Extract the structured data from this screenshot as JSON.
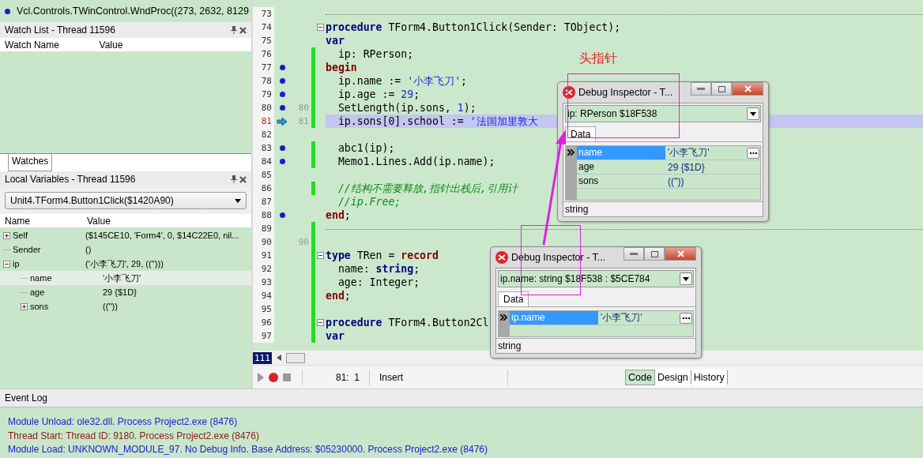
{
  "call_stack": {
    "entries": [
      {
        "text": "Vcl.Controls.TWinControl.WndProc((273, 2632, 8129"
      }
    ]
  },
  "watch_list": {
    "title": "Watch List - Thread 11596",
    "columns": [
      "Watch Name",
      "Value"
    ],
    "tabs": [
      {
        "label": "Watches",
        "selected": true
      }
    ]
  },
  "local_variables": {
    "title": "Local Variables - Thread 11596",
    "frame": "Unit4.TForm4.Button1Click($1420A90)",
    "columns": [
      "Name",
      "Value"
    ],
    "rows": [
      {
        "kind": "branch",
        "expanded": false,
        "selected": false,
        "name": "Self",
        "value": "($145CE10, 'Form4', 0, $14C22E0, nil..."
      },
      {
        "kind": "leaf",
        "selected": false,
        "name": "Sender",
        "value": "()"
      },
      {
        "kind": "branch",
        "expanded": true,
        "selected": false,
        "name": "ip",
        "value": "('小李飞刀', 29, (('')))",
        "children": [
          {
            "kind": "leaf",
            "selected": true,
            "name": "name",
            "value": "'小李飞刀'"
          },
          {
            "kind": "leaf",
            "selected": false,
            "name": "age",
            "value": "29 {$1D}"
          },
          {
            "kind": "branch",
            "expanded": false,
            "selected": false,
            "name": "sons",
            "value": "((''))"
          }
        ]
      }
    ]
  },
  "editor": {
    "lines": [
      {
        "number": "73",
        "kind": "separator",
        "breakpoint": false,
        "current": false,
        "modified": false,
        "fold": false
      },
      {
        "number": "74",
        "kind": "code",
        "breakpoint": false,
        "current": false,
        "modified": false,
        "fold": true,
        "tokens": [
          {
            "kind": "keyword",
            "text": "procedure"
          },
          {
            "kind": "plain",
            "text": " TForm4.Button1Click(Sender: TObject);"
          }
        ]
      },
      {
        "number": "75",
        "kind": "code",
        "breakpoint": false,
        "current": false,
        "modified": false,
        "fold": false,
        "tokens": [
          {
            "kind": "keyword",
            "text": "var"
          }
        ]
      },
      {
        "number": "76",
        "kind": "code",
        "breakpoint": false,
        "current": false,
        "modified": true,
        "fold": false,
        "tokens": [
          {
            "kind": "plain",
            "text": "  ip: RPerson;"
          }
        ]
      },
      {
        "number": "77",
        "kind": "code",
        "breakpoint": true,
        "current": false,
        "modified": true,
        "fold": false,
        "tokens": [
          {
            "kind": "block",
            "text": "begin"
          }
        ]
      },
      {
        "number": "78",
        "kind": "code",
        "breakpoint": true,
        "current": false,
        "modified": true,
        "fold": false,
        "tokens": [
          {
            "kind": "plain",
            "text": "  ip.name := "
          },
          {
            "kind": "string",
            "text": "'小李飞刀'"
          },
          {
            "kind": "plain",
            "text": ";"
          }
        ]
      },
      {
        "number": "79",
        "kind": "code",
        "breakpoint": true,
        "current": false,
        "modified": true,
        "fold": false,
        "tokens": [
          {
            "kind": "plain",
            "text": "  ip.age := "
          },
          {
            "kind": "number",
            "text": "29"
          },
          {
            "kind": "plain",
            "text": ";"
          }
        ]
      },
      {
        "number": "80",
        "kind": "code",
        "compiled": "80",
        "breakpoint": true,
        "current": false,
        "modified": true,
        "fold": false,
        "tokens": [
          {
            "kind": "plain",
            "text": "  SetLength(ip.sons, "
          },
          {
            "kind": "number",
            "text": "1"
          },
          {
            "kind": "plain",
            "text": ");"
          }
        ]
      },
      {
        "number": "81",
        "kind": "code",
        "compiled": "81",
        "breakpoint": false,
        "current": true,
        "modified": true,
        "fold": false,
        "tokens": [
          {
            "kind": "plain",
            "text": "  ip.sons[0].school := "
          },
          {
            "kind": "string",
            "text": "'法国加里敦大"
          }
        ]
      },
      {
        "number": "82",
        "kind": "code",
        "breakpoint": false,
        "current": false,
        "modified": false,
        "fold": false
      },
      {
        "number": "83",
        "kind": "code",
        "breakpoint": true,
        "current": false,
        "modified": true,
        "fold": false,
        "tokens": [
          {
            "kind": "plain",
            "text": "  abc1(ip);"
          }
        ]
      },
      {
        "number": "84",
        "kind": "code",
        "breakpoint": true,
        "current": false,
        "modified": true,
        "fold": false,
        "tokens": [
          {
            "kind": "plain",
            "text": "  Memo1.Lines.Add(ip.name);"
          }
        ]
      },
      {
        "number": "85",
        "kind": "code",
        "breakpoint": false,
        "current": false,
        "modified": false,
        "fold": false
      },
      {
        "number": "86",
        "kind": "code",
        "breakpoint": false,
        "current": false,
        "modified": true,
        "fold": false,
        "tokens": [
          {
            "kind": "comment",
            "text": "  //结构不需要释放,指针出栈后,引用计"
          }
        ]
      },
      {
        "number": "87",
        "kind": "code",
        "breakpoint": false,
        "current": false,
        "modified": false,
        "fold": false,
        "tokens": [
          {
            "kind": "comment",
            "text": "  //ip.Free;"
          }
        ]
      },
      {
        "number": "88",
        "kind": "code",
        "breakpoint": true,
        "current": false,
        "modified": false,
        "fold": false,
        "tokens": [
          {
            "kind": "block",
            "text": "end"
          },
          {
            "kind": "plain",
            "text": ";"
          }
        ]
      },
      {
        "number": "89",
        "kind": "separator",
        "breakpoint": false,
        "current": false,
        "modified": true,
        "fold": false
      },
      {
        "number": "90",
        "kind": "code",
        "compiled": "90",
        "breakpoint": false,
        "current": false,
        "modified": true,
        "fold": false
      },
      {
        "number": "91",
        "kind": "code",
        "breakpoint": false,
        "current": false,
        "modified": true,
        "fold": true,
        "tokens": [
          {
            "kind": "keyword",
            "text": "type"
          },
          {
            "kind": "plain",
            "text": " TRen = "
          },
          {
            "kind": "block",
            "text": "record"
          }
        ]
      },
      {
        "number": "92",
        "kind": "code",
        "breakpoint": false,
        "current": false,
        "modified": true,
        "fold": false,
        "tokens": [
          {
            "kind": "plain",
            "text": "  name: "
          },
          {
            "kind": "keyword",
            "text": "string"
          },
          {
            "kind": "plain",
            "text": ";"
          }
        ]
      },
      {
        "number": "93",
        "kind": "code",
        "breakpoint": false,
        "current": false,
        "modified": true,
        "fold": false,
        "tokens": [
          {
            "kind": "plain",
            "text": "  age: Integer;"
          }
        ]
      },
      {
        "number": "94",
        "kind": "code",
        "breakpoint": false,
        "current": false,
        "modified": true,
        "fold": false,
        "tokens": [
          {
            "kind": "block",
            "text": "end"
          },
          {
            "kind": "plain",
            "text": ";"
          }
        ]
      },
      {
        "number": "95",
        "kind": "code",
        "breakpoint": false,
        "current": false,
        "modified": true,
        "fold": false
      },
      {
        "number": "96",
        "kind": "code",
        "breakpoint": false,
        "current": false,
        "modified": true,
        "fold": true,
        "tokens": [
          {
            "kind": "keyword",
            "text": "procedure"
          },
          {
            "kind": "plain",
            "text": " TForm4.Button2Cl"
          }
        ]
      },
      {
        "number": "97",
        "kind": "code",
        "breakpoint": false,
        "current": false,
        "modified": true,
        "fold": false,
        "tokens": [
          {
            "kind": "keyword",
            "text": "var"
          }
        ]
      }
    ],
    "bottom_line": "111"
  },
  "status_bar": {
    "position": "81:  1",
    "mode": "Insert",
    "tabs": [
      {
        "label": "Code",
        "selected": true
      },
      {
        "label": "Design",
        "selected": false
      },
      {
        "label": "History",
        "selected": false
      }
    ]
  },
  "inspectors": [
    {
      "title": "Debug Inspector - T...",
      "expression": "ip: RPerson $18F538",
      "tab": "Data",
      "footer": "string",
      "rows": [
        {
          "name": "name",
          "value": "'小李飞刀'",
          "selected": true
        },
        {
          "name": "age",
          "value": "29 {$1D}",
          "selected": false
        },
        {
          "name": "sons",
          "value": "((''))",
          "selected": false
        }
      ]
    },
    {
      "title": "Debug Inspector - T...",
      "expression": "ip.name: string $18F538 : $5CE784",
      "tab": "Data",
      "footer": "string",
      "rows": [
        {
          "name": "ip.name",
          "value": "'小李飞刀'",
          "selected": true
        }
      ]
    }
  ],
  "annotation": {
    "label": "头指针"
  },
  "event_log": {
    "title": "Event Log",
    "entries": [
      {
        "kind": "module",
        "text": "Module Unload: ole32.dll. Process Project2.exe (8476)"
      },
      {
        "kind": "thread",
        "text": "Thread Start: Thread ID: 9180. Process Project2.exe (8476)"
      },
      {
        "kind": "module",
        "text": "Module Load: UNKNOWN_MODULE_97. No Debug Info. Base Address: $05230000. Process Project2.exe (8476)"
      }
    ]
  }
}
